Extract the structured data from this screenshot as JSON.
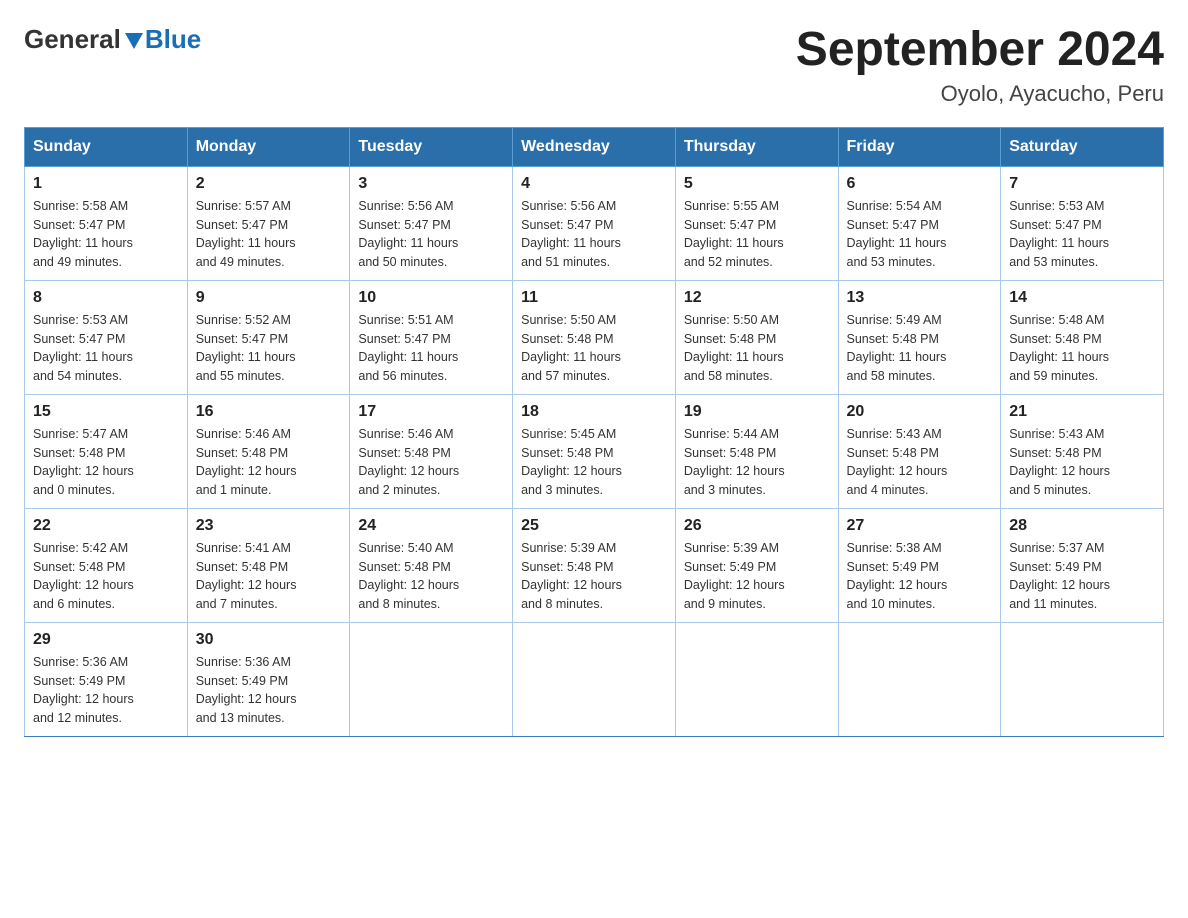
{
  "header": {
    "title": "September 2024",
    "subtitle": "Oyolo, Ayacucho, Peru",
    "logo_general": "General",
    "logo_blue": "Blue"
  },
  "calendar": {
    "weekdays": [
      "Sunday",
      "Monday",
      "Tuesday",
      "Wednesday",
      "Thursday",
      "Friday",
      "Saturday"
    ],
    "weeks": [
      [
        {
          "day": 1,
          "sunrise": "5:58 AM",
          "sunset": "5:47 PM",
          "daylight": "11 hours and 49 minutes."
        },
        {
          "day": 2,
          "sunrise": "5:57 AM",
          "sunset": "5:47 PM",
          "daylight": "11 hours and 49 minutes."
        },
        {
          "day": 3,
          "sunrise": "5:56 AM",
          "sunset": "5:47 PM",
          "daylight": "11 hours and 50 minutes."
        },
        {
          "day": 4,
          "sunrise": "5:56 AM",
          "sunset": "5:47 PM",
          "daylight": "11 hours and 51 minutes."
        },
        {
          "day": 5,
          "sunrise": "5:55 AM",
          "sunset": "5:47 PM",
          "daylight": "11 hours and 52 minutes."
        },
        {
          "day": 6,
          "sunrise": "5:54 AM",
          "sunset": "5:47 PM",
          "daylight": "11 hours and 53 minutes."
        },
        {
          "day": 7,
          "sunrise": "5:53 AM",
          "sunset": "5:47 PM",
          "daylight": "11 hours and 53 minutes."
        }
      ],
      [
        {
          "day": 8,
          "sunrise": "5:53 AM",
          "sunset": "5:47 PM",
          "daylight": "11 hours and 54 minutes."
        },
        {
          "day": 9,
          "sunrise": "5:52 AM",
          "sunset": "5:47 PM",
          "daylight": "11 hours and 55 minutes."
        },
        {
          "day": 10,
          "sunrise": "5:51 AM",
          "sunset": "5:47 PM",
          "daylight": "11 hours and 56 minutes."
        },
        {
          "day": 11,
          "sunrise": "5:50 AM",
          "sunset": "5:48 PM",
          "daylight": "11 hours and 57 minutes."
        },
        {
          "day": 12,
          "sunrise": "5:50 AM",
          "sunset": "5:48 PM",
          "daylight": "11 hours and 58 minutes."
        },
        {
          "day": 13,
          "sunrise": "5:49 AM",
          "sunset": "5:48 PM",
          "daylight": "11 hours and 58 minutes."
        },
        {
          "day": 14,
          "sunrise": "5:48 AM",
          "sunset": "5:48 PM",
          "daylight": "11 hours and 59 minutes."
        }
      ],
      [
        {
          "day": 15,
          "sunrise": "5:47 AM",
          "sunset": "5:48 PM",
          "daylight": "12 hours and 0 minutes."
        },
        {
          "day": 16,
          "sunrise": "5:46 AM",
          "sunset": "5:48 PM",
          "daylight": "12 hours and 1 minute."
        },
        {
          "day": 17,
          "sunrise": "5:46 AM",
          "sunset": "5:48 PM",
          "daylight": "12 hours and 2 minutes."
        },
        {
          "day": 18,
          "sunrise": "5:45 AM",
          "sunset": "5:48 PM",
          "daylight": "12 hours and 3 minutes."
        },
        {
          "day": 19,
          "sunrise": "5:44 AM",
          "sunset": "5:48 PM",
          "daylight": "12 hours and 3 minutes."
        },
        {
          "day": 20,
          "sunrise": "5:43 AM",
          "sunset": "5:48 PM",
          "daylight": "12 hours and 4 minutes."
        },
        {
          "day": 21,
          "sunrise": "5:43 AM",
          "sunset": "5:48 PM",
          "daylight": "12 hours and 5 minutes."
        }
      ],
      [
        {
          "day": 22,
          "sunrise": "5:42 AM",
          "sunset": "5:48 PM",
          "daylight": "12 hours and 6 minutes."
        },
        {
          "day": 23,
          "sunrise": "5:41 AM",
          "sunset": "5:48 PM",
          "daylight": "12 hours and 7 minutes."
        },
        {
          "day": 24,
          "sunrise": "5:40 AM",
          "sunset": "5:48 PM",
          "daylight": "12 hours and 8 minutes."
        },
        {
          "day": 25,
          "sunrise": "5:39 AM",
          "sunset": "5:48 PM",
          "daylight": "12 hours and 8 minutes."
        },
        {
          "day": 26,
          "sunrise": "5:39 AM",
          "sunset": "5:49 PM",
          "daylight": "12 hours and 9 minutes."
        },
        {
          "day": 27,
          "sunrise": "5:38 AM",
          "sunset": "5:49 PM",
          "daylight": "12 hours and 10 minutes."
        },
        {
          "day": 28,
          "sunrise": "5:37 AM",
          "sunset": "5:49 PM",
          "daylight": "12 hours and 11 minutes."
        }
      ],
      [
        {
          "day": 29,
          "sunrise": "5:36 AM",
          "sunset": "5:49 PM",
          "daylight": "12 hours and 12 minutes."
        },
        {
          "day": 30,
          "sunrise": "5:36 AM",
          "sunset": "5:49 PM",
          "daylight": "12 hours and 13 minutes."
        },
        null,
        null,
        null,
        null,
        null
      ]
    ]
  }
}
